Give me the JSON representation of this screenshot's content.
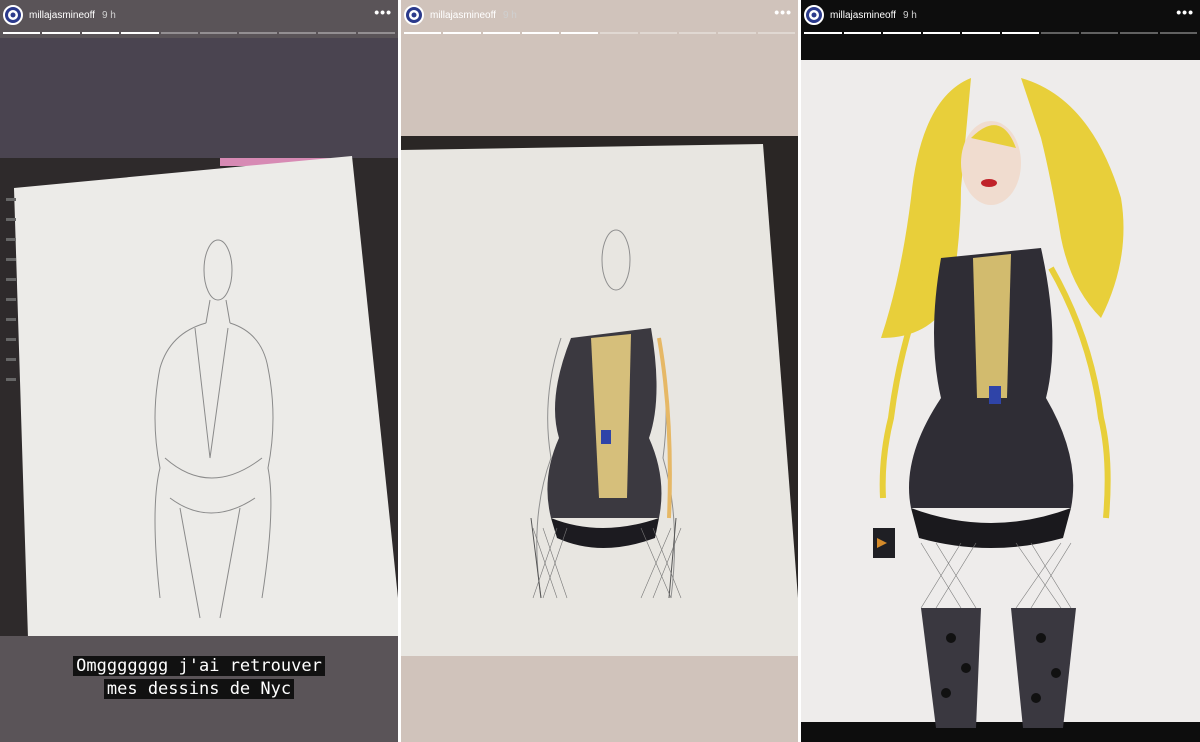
{
  "stories": [
    {
      "username": "millajasmineoff",
      "time": "9 h",
      "more_icon": "more-dots-icon",
      "progress_segments": 10,
      "progress_done": 4,
      "caption_lines": [
        "Omggggggg j'ai retrouver",
        "mes dessins de Nyc"
      ]
    },
    {
      "username": "millajasmineoff",
      "time": "9 h",
      "more_icon": "more-dots-icon",
      "progress_segments": 10,
      "progress_done": 5
    },
    {
      "username": "millajasmineoff",
      "time": "9 h",
      "more_icon": "more-dots-icon",
      "progress_segments": 10,
      "progress_done": 6
    }
  ],
  "colors": {
    "avatar_ring": "#ffffff",
    "avatar_fill": "#2b3a8c",
    "caption_bg": "#111111"
  }
}
